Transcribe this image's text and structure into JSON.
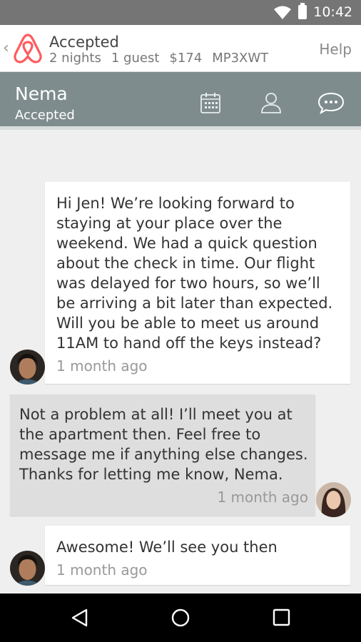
{
  "status_bar": {
    "time": "10:42"
  },
  "reservation": {
    "status": "Accepted",
    "nights": "2 nights",
    "guests": "1 guest",
    "price": "$174",
    "code": "MP3XWT",
    "help": "Help"
  },
  "guest": {
    "name": "Nema",
    "status": "Accepted"
  },
  "messages": [
    {
      "text": "Hi Jen! We’re looking forward to\nstaying at your place over the\nweekend. We had a quick question\nabout the check in time. Our flight\nwas delayed for two hours, so we’ll\nbe arriving a bit later than expected.\nWill you be able to meet us around\n11AM to hand off the keys instead?",
      "time": "1 month ago"
    },
    {
      "text": "Not a problem at all! I’ll meet you at\nthe apartment then. Feel free to\nmessage me if anything else changes.\nThanks for letting me know, Nema.",
      "time": "1 month ago"
    },
    {
      "text": "Awesome! We’ll see you then",
      "time": "1 month ago"
    }
  ],
  "colors": {
    "accent": "#ff5a5f",
    "guest_bar": "#7f8c8d",
    "outgoing_bubble": "#dedede"
  },
  "icons": [
    "wifi-icon",
    "battery-icon",
    "back-chevron-icon",
    "airbnb-logo",
    "calendar-icon",
    "profile-icon",
    "chat-icon",
    "nav-back-icon",
    "nav-home-icon",
    "nav-recents-icon"
  ]
}
